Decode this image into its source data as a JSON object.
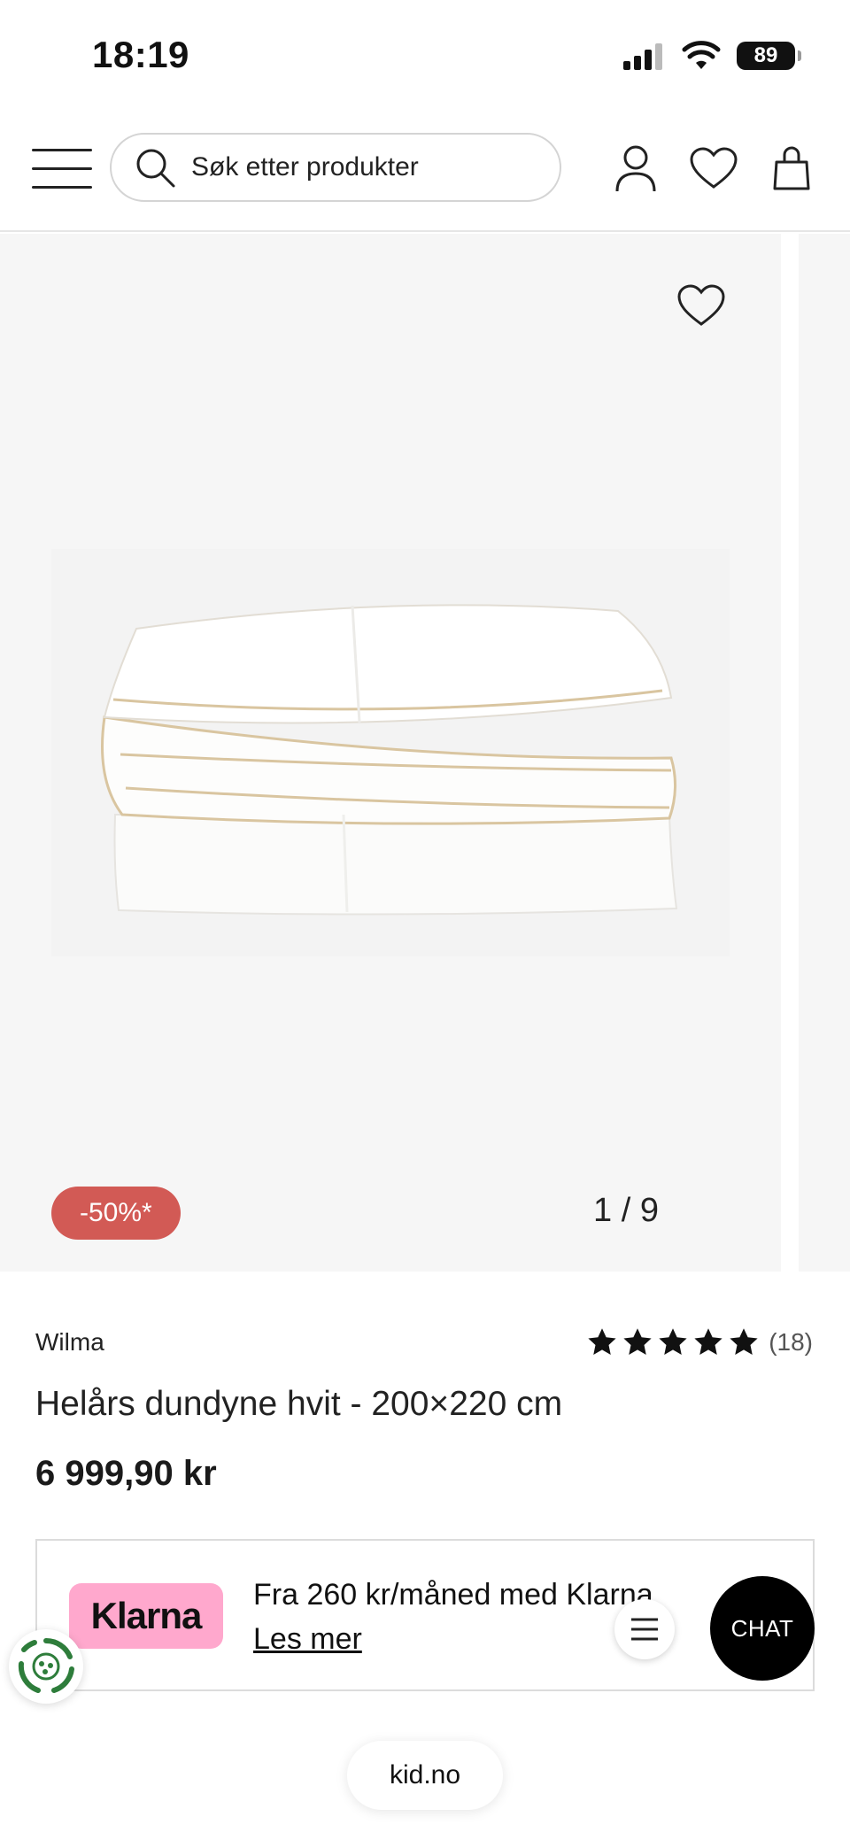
{
  "status_bar": {
    "time": "18:19",
    "battery": "89"
  },
  "header": {
    "search": {
      "placeholder": "Søk etter produkter"
    },
    "icons": [
      "menu-icon",
      "search-icon",
      "user-icon",
      "heart-icon",
      "shopping-bag-icon"
    ]
  },
  "gallery": {
    "discount_badge": "-50%*",
    "counter": "1 / 9"
  },
  "product": {
    "brand": "Wilma",
    "rating": {
      "stars": 5,
      "count": "(18)"
    },
    "title": "Helårs dundyne hvit - 200×220 cm",
    "price": "6 999,90 kr"
  },
  "klarna": {
    "logo": "Klarna",
    "text": "Fra 260 kr/måned med Klarna",
    "link": "Les mer"
  },
  "floating": {
    "chat": "CHAT"
  },
  "browser": {
    "url": "kid.no"
  },
  "colors": {
    "discount": "#d25a55",
    "klarna": "#ffa8cd",
    "chat": "#000000"
  }
}
